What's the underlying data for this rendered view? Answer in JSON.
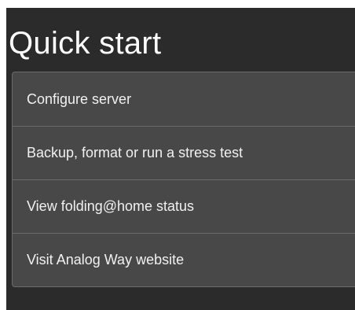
{
  "quick_start": {
    "title": "Quick start",
    "items": [
      {
        "label": "Configure server"
      },
      {
        "label": "Backup, format or run a stress test"
      },
      {
        "label": "View folding@home status"
      },
      {
        "label": "Visit Analog Way website"
      }
    ]
  },
  "colors": {
    "panel_background": "#2b2b2b",
    "item_background": "#484848",
    "item_border": "#6b6b6b",
    "title_text": "#ffffff",
    "item_text": "#f1f1f1"
  }
}
